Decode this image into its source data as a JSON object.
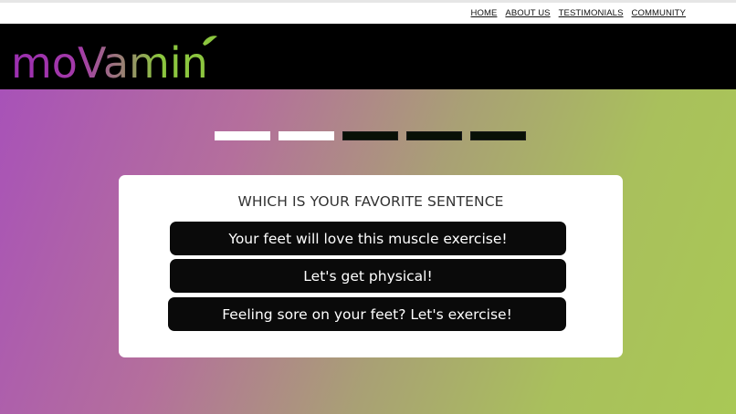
{
  "nav": {
    "links": [
      "HOME",
      "ABOUT US",
      "TESTIMONIALS",
      "COMMUNITY"
    ]
  },
  "brand": {
    "name": "moVamin",
    "colors": {
      "purple": "#9b2fb0",
      "green": "#8cc63f"
    }
  },
  "progress": {
    "total_steps": 5,
    "completed_steps": 2
  },
  "quiz": {
    "question": "WHICH IS YOUR FAVORITE SENTENCE",
    "options": [
      "Your feet will love this muscle exercise!",
      "Let's get physical!",
      "Feeling sore on your feet? Let's exercise!"
    ]
  },
  "colors": {
    "header_bg": "#000000",
    "option_bg": "#0a0a0a",
    "card_bg": "#ffffff"
  }
}
